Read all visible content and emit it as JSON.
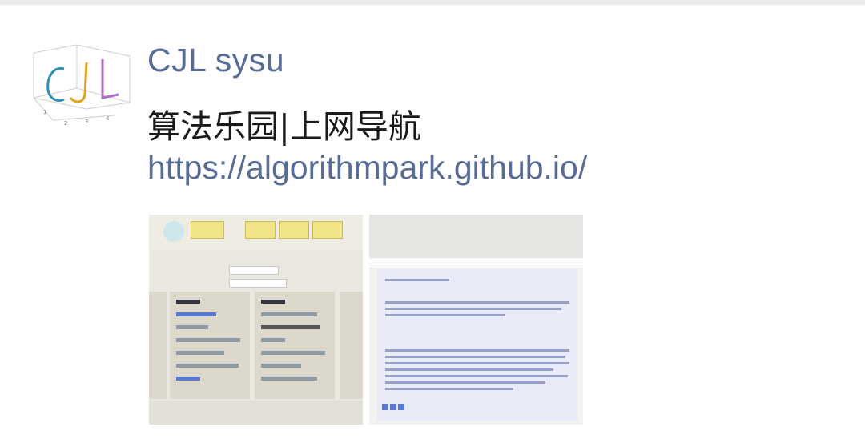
{
  "post": {
    "author": "CJL sysu",
    "title": "算法乐园|上网导航",
    "url": "https://algorithmpark.github.io/"
  },
  "avatar": {
    "letters": "CJL",
    "axis_ticks": [
      "1",
      "2",
      "3",
      "4"
    ]
  },
  "colors": {
    "link": "#576b95",
    "title": "#1a1a1a",
    "avatar_c": "#2f8fb5",
    "avatar_j": "#e0a21a",
    "avatar_l": "#b06cc8"
  },
  "thumbnails": [
    {
      "name": "website-navigation-screenshot"
    },
    {
      "name": "document-page-screenshot"
    }
  ]
}
